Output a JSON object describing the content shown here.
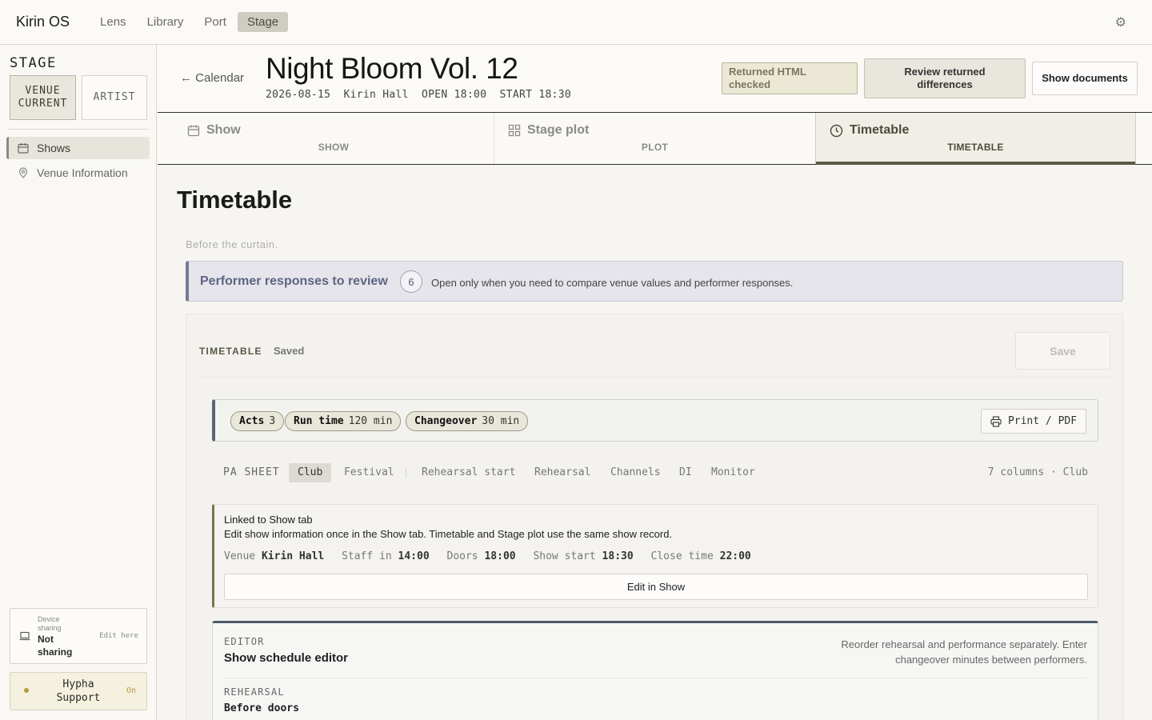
{
  "app": {
    "brand": "Kirin OS",
    "nav": [
      {
        "label": "Lens",
        "active": false
      },
      {
        "label": "Library",
        "active": false
      },
      {
        "label": "Port",
        "active": false
      },
      {
        "label": "Stage",
        "active": true
      }
    ],
    "settings_icon": "gear-icon"
  },
  "sidebar": {
    "title": "STAGE",
    "roles": [
      {
        "line1": "VENUE",
        "line2": "CURRENT",
        "active": true
      },
      {
        "line1": "ARTIST",
        "active": false
      }
    ],
    "items": [
      {
        "label": "Shows",
        "icon": "calendar-icon",
        "active": true
      },
      {
        "label": "Venue Information",
        "icon": "map-pin-icon",
        "active": false
      }
    ],
    "device": {
      "small_label": "Device sharing",
      "status": "Not sharing",
      "edit": "Edit here",
      "icon": "laptop-icon"
    },
    "support": {
      "label": "Hypha Support",
      "state": "On",
      "dot_color": "#b49b3a"
    }
  },
  "header": {
    "back": "← Calendar",
    "title": "Night Bloom Vol. 12",
    "meta": "2026-08-15  Kirin Hall  OPEN 18:00  START 18:30",
    "buttons": {
      "returned": "Returned HTML checked",
      "review": "Review returned differences",
      "documents": "Show documents"
    }
  },
  "tabs": [
    {
      "title": "Show",
      "sub": "SHOW",
      "icon": "calendar-icon",
      "active": false
    },
    {
      "title": "Stage plot",
      "sub": "PLOT",
      "icon": "grid-icon",
      "active": false
    },
    {
      "title": "Timetable",
      "sub": "TIMETABLE",
      "icon": "clock-icon",
      "active": true
    }
  ],
  "main": {
    "title": "Timetable",
    "before_curtain": "Before the curtain.",
    "performer": {
      "title": "Performer responses to review",
      "count": "6",
      "desc": "Open only when you need to compare venue values and performer responses."
    },
    "panel": {
      "label": "TIMETABLE",
      "status": "Saved",
      "save": "Save",
      "stats": [
        {
          "key": "Acts",
          "value": "3"
        },
        {
          "key": "Run time",
          "value": "120 min"
        },
        {
          "key": "Changeover",
          "value": "30 min"
        }
      ],
      "print": "Print / PDF",
      "pa": {
        "label": "PA SHEET",
        "presets": [
          {
            "label": "Club",
            "active": true
          },
          {
            "label": "Festival",
            "active": false
          }
        ],
        "columns": [
          "Rehearsal start",
          "Rehearsal",
          "Channels",
          "DI",
          "Monitor"
        ],
        "summary": "7 columns · Club"
      },
      "linked": {
        "title": "Linked to Show tab",
        "desc": "Edit show information once in the Show tab. Timetable and Stage plot use the same show record.",
        "fields": [
          {
            "key": "Venue",
            "value": "Kirin Hall"
          },
          {
            "key": "Staff in",
            "value": "14:00"
          },
          {
            "key": "Doors",
            "value": "18:00"
          },
          {
            "key": "Show start",
            "value": "18:30"
          },
          {
            "key": "Close time",
            "value": "22:00"
          }
        ],
        "edit": "Edit in Show"
      },
      "editor": {
        "label": "EDITOR",
        "title": "Show schedule editor",
        "note": "Reorder rehearsal and performance separately. Enter changeover minutes between performers.",
        "rehearsal_label": "REHEARSAL",
        "rehearsal_title": "Before doors"
      }
    }
  }
}
